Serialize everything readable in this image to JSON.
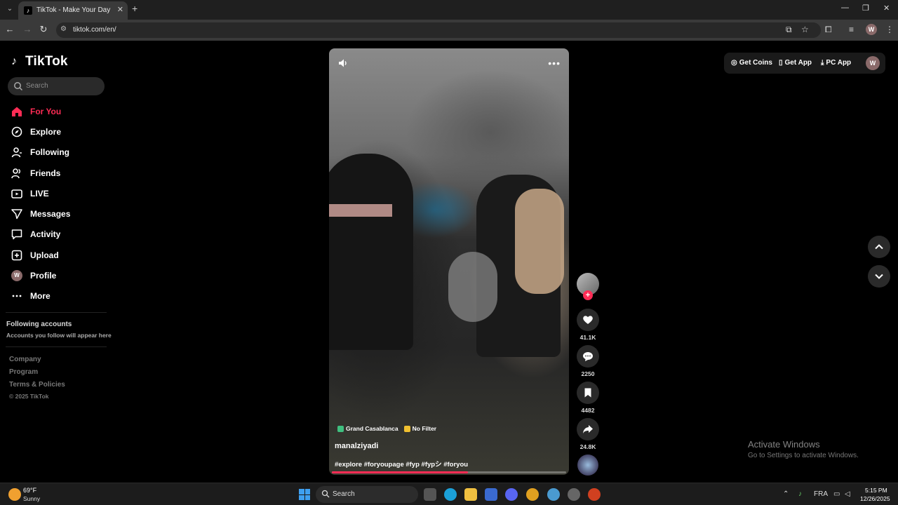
{
  "browser": {
    "tab_title": "TikTok - Make Your Day",
    "url": "tiktok.com/en/",
    "profile_initial": "W"
  },
  "sidebar": {
    "logo_text": "TikTok",
    "search_placeholder": "Search",
    "items": [
      {
        "label": "For You",
        "icon": "home-icon",
        "active": true
      },
      {
        "label": "Explore",
        "icon": "compass-icon"
      },
      {
        "label": "Following",
        "icon": "person-icon"
      },
      {
        "label": "Friends",
        "icon": "friends-icon"
      },
      {
        "label": "LIVE",
        "icon": "live-icon"
      },
      {
        "label": "Messages",
        "icon": "send-icon"
      },
      {
        "label": "Activity",
        "icon": "message-box-icon"
      },
      {
        "label": "Upload",
        "icon": "plus-square-icon"
      },
      {
        "label": "Profile",
        "icon": "avatar",
        "initial": "W"
      },
      {
        "label": "More",
        "icon": "ellipsis-icon"
      }
    ],
    "following_header": "Following accounts",
    "following_sub": "Accounts you follow will appear here",
    "footer_links": [
      "Company",
      "Program",
      "Terms & Policies"
    ],
    "copyright": "© 2025 TikTok"
  },
  "video": {
    "location_tag": "Grand Casablanca",
    "filter_tag": "No Filter",
    "author": "manalziyadi",
    "caption": "#explore #foryoupage #fyp #fypシ #foryou",
    "progress": 0.58
  },
  "actions": {
    "likes": "41.1K",
    "comments": "2250",
    "saves": "4482",
    "shares": "24.8K"
  },
  "topbar": {
    "get_coins": "Get Coins",
    "get_app": "Get App",
    "pc_app": "PC App",
    "avatar_initial": "W"
  },
  "watermark": {
    "title": "Activate Windows",
    "sub": "Go to Settings to activate Windows."
  },
  "taskbar": {
    "temp": "69°F",
    "condition": "Sunny",
    "search": "Search",
    "lang": "FRA",
    "time": "5:15 PM",
    "date": "12/26/2025"
  },
  "colors": {
    "accent": "#fe2c55",
    "bg": "#000000",
    "button_bg": "#2a2a2a"
  }
}
